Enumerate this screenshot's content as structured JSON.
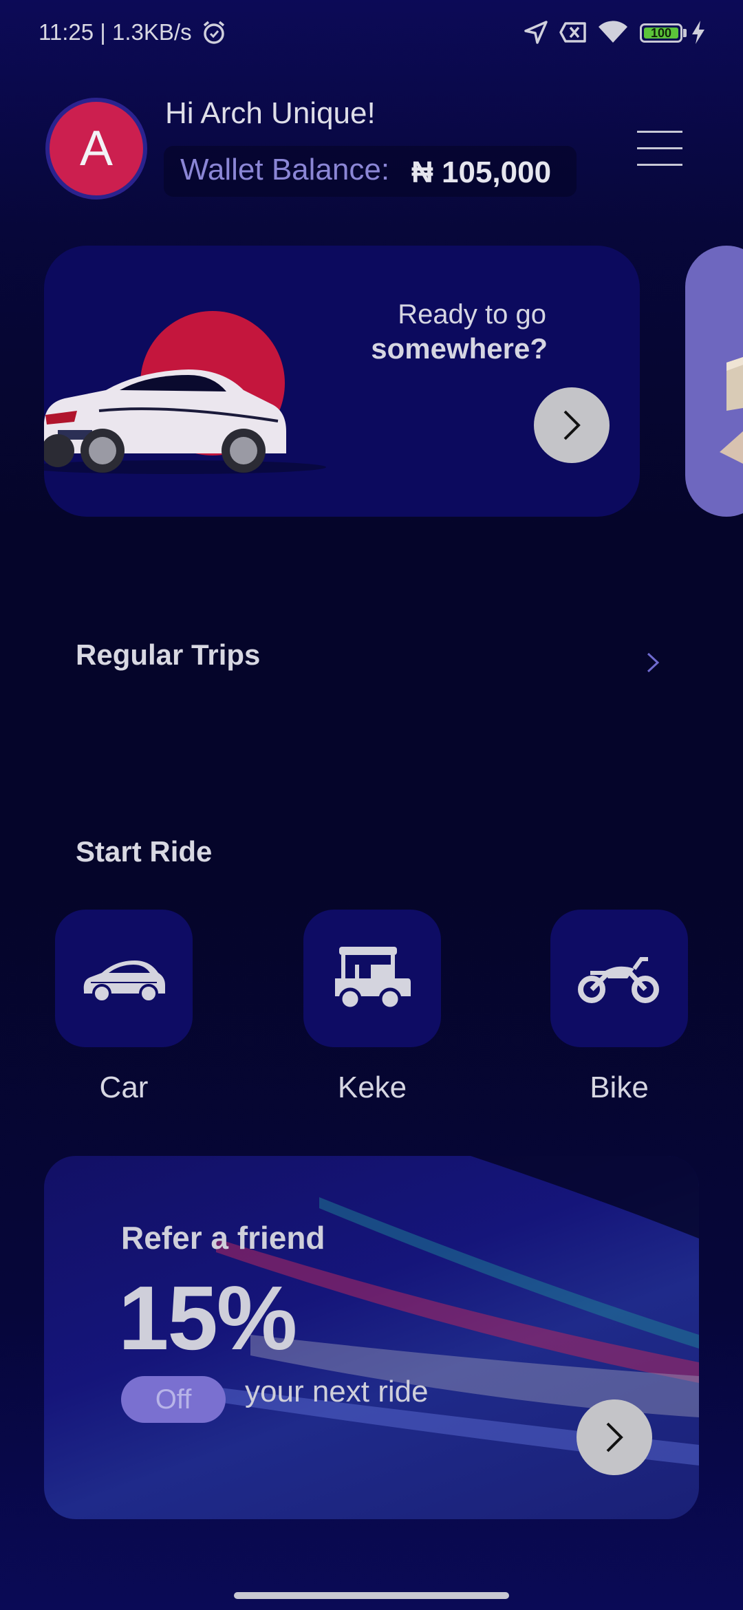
{
  "status_bar": {
    "time_speed": "11:25 | 1.3KB/s",
    "battery": "100",
    "icons": [
      "alarm-icon",
      "location-arrow-icon",
      "sim-off-icon",
      "wifi-icon",
      "battery-icon",
      "charging-icon"
    ]
  },
  "header": {
    "avatar_initial": "A",
    "greeting": "Hi Arch Unique!",
    "wallet_label": "Wallet Balance:",
    "wallet_amount": "₦ 105,000",
    "menu_icon": "hamburger-menu-icon"
  },
  "promo": {
    "line1": "Ready to go",
    "line2": "somewhere?",
    "image": "car-illustration",
    "button_icon": "chevron-right-icon"
  },
  "regular_trips": {
    "title": "Regular Trips",
    "icon": "chevron-right-icon"
  },
  "start_ride": {
    "title": "Start Ride",
    "options": [
      {
        "label": "Car",
        "icon": "car-icon"
      },
      {
        "label": "Keke",
        "icon": "keke-icon"
      },
      {
        "label": "Bike",
        "icon": "motorbike-icon"
      }
    ]
  },
  "refer": {
    "subtitle": "Refer a friend",
    "percent": "15%",
    "badge": "Off",
    "text": "your next ride",
    "button_icon": "chevron-right-icon"
  },
  "colors": {
    "background": "#05052a",
    "card": "#0c0a5e",
    "avatar": "#cc1f4f",
    "accent_circle": "#c4163d",
    "off_pill": "#7a70d0"
  }
}
